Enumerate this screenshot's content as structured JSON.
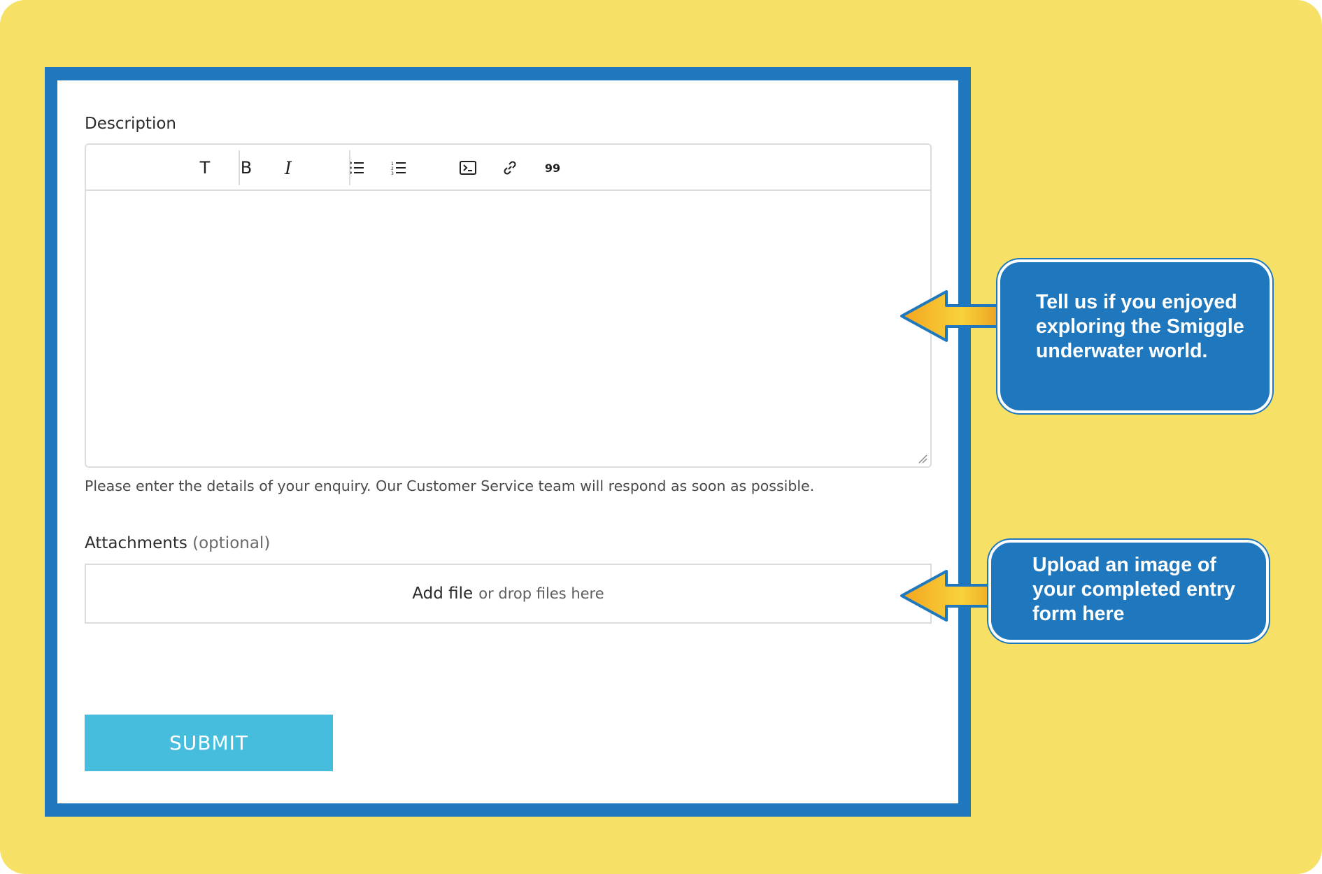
{
  "form": {
    "description_label": "Description",
    "helper_text": "Please enter the details of your enquiry. Our Customer Service team will respond as soon as possible.",
    "attachments_label": "Attachments",
    "attachments_optional": "(optional)",
    "add_file": "Add file",
    "drop_text": "or drop files here",
    "submit_label": "SUBMIT"
  },
  "toolbar": {
    "text_label": "T",
    "bold_label": "B",
    "italic_label": "I",
    "quote_label": "99"
  },
  "callouts": {
    "description_tip": "Tell us if you enjoyed exploring the Smiggle underwater world.",
    "attachment_tip": "Upload an image of your completed entry form here"
  },
  "colors": {
    "background": "#f6e166",
    "frame": "#1f77bd",
    "submit": "#46bddd",
    "arrow_fill": "#f3b32a"
  },
  "icons": [
    "bulleted-list-icon",
    "numbered-list-icon",
    "code-block-icon",
    "link-icon",
    "quote-icon",
    "resize-handle-icon",
    "arrow-left-icon"
  ]
}
